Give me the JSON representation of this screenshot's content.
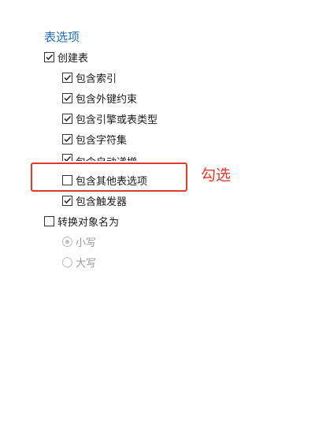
{
  "section": {
    "title": "表选项"
  },
  "options": {
    "create_table": {
      "label": "创建表",
      "checked": true
    },
    "include_index": {
      "label": "包含索引",
      "checked": true
    },
    "include_foreign_key": {
      "label": "包含外键约束",
      "checked": true
    },
    "include_engine": {
      "label": "包含引擎或表类型",
      "checked": true
    },
    "include_charset": {
      "label": "包含字符集",
      "checked": true
    },
    "include_auto_increment": {
      "label": "包含自动递增",
      "checked": true
    },
    "include_other_table_options": {
      "label": "包含其他表选项",
      "checked": false
    },
    "include_triggers": {
      "label": "包含触发器",
      "checked": true
    },
    "convert_object_names": {
      "label": "转换对象名为",
      "checked": false
    }
  },
  "case_options": {
    "lowercase": {
      "label": "小写",
      "selected": true,
      "enabled": false
    },
    "uppercase": {
      "label": "大写",
      "selected": false,
      "enabled": false
    }
  },
  "annotation": {
    "text": "勾选",
    "color": "#e03a2f"
  },
  "colors": {
    "title": "#1f6fb3",
    "highlight": "#e03a2f",
    "disabled": "#9a9a9a"
  }
}
